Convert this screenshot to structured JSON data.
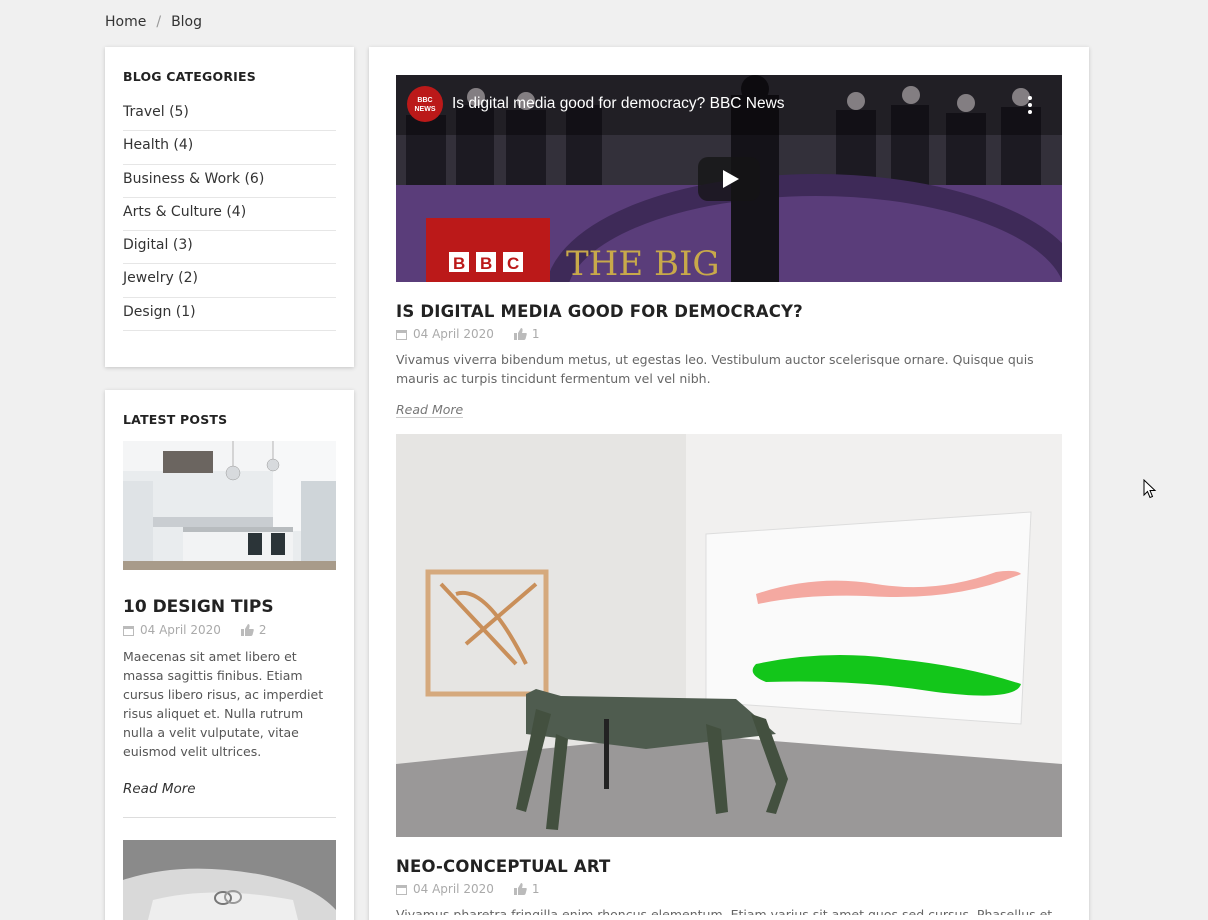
{
  "breadcrumb": {
    "home": "Home",
    "separator": "/",
    "current": "Blog"
  },
  "categories": {
    "title": "BLOG CATEGORIES",
    "items": [
      "Travel (5)",
      "Health (4)",
      "Business & Work (6)",
      "Arts & Culture (4)",
      "Digital (3)",
      "Jewelry (2)",
      "Design (1)"
    ]
  },
  "latest": {
    "title": "LATEST POSTS",
    "post": {
      "title": "10 DESIGN TIPS",
      "date": "04 April 2020",
      "likes": "2",
      "text": "Maecenas sit amet libero et massa sagittis finibus. Etiam cursus libero risus, ac imperdiet risus aliquet et. Nulla rutrum nulla a velit vulputate, vitae euismod velit ultrices.",
      "read_more": "Read More"
    }
  },
  "posts": [
    {
      "video_title": "Is digital media good for democracy? BBC News",
      "video_channel_badge": "BBC NEWS",
      "video_logo": "BBC",
      "video_overlay_text": "THE BIG",
      "title": "IS DIGITAL MEDIA GOOD FOR DEMOCRACY?",
      "date": "04 April 2020",
      "likes": "1",
      "text": "Vivamus viverra bibendum metus, ut egestas leo. Vestibulum auctor scelerisque ornare. Quisque quis mauris ac turpis tincidunt fermentum vel vel nibh.",
      "read_more": "Read More"
    },
    {
      "title": "NEO-CONCEPTUAL ART",
      "date": "04 April 2020",
      "likes": "1",
      "text": "Vivamus pharetra fringilla enim rhoncus elementum. Etiam varius sit amet quos sed cursus. Phasellus et feugiat"
    }
  ],
  "colors": {
    "bbc_red": "#bb1919",
    "purple_floor": "#5a3d7a"
  }
}
